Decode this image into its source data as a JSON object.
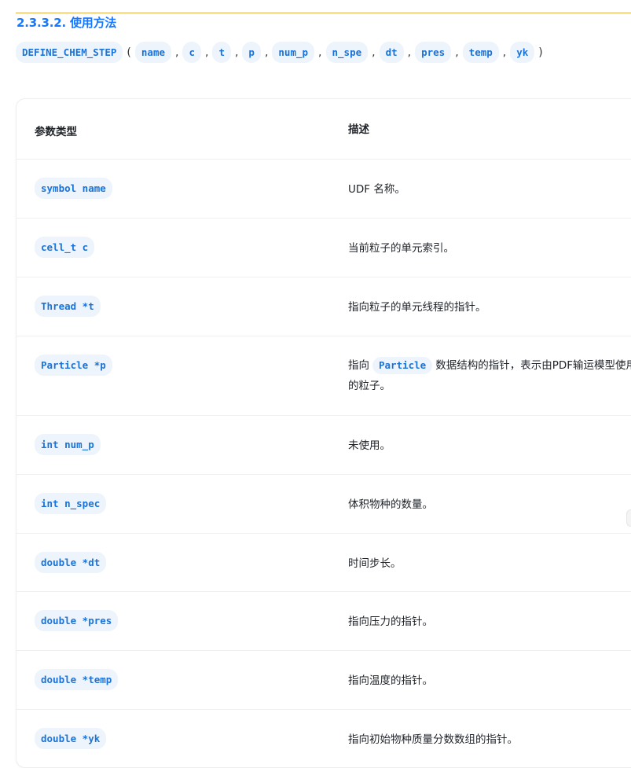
{
  "section": {
    "number_title": "2.3.3.2. 使用方法"
  },
  "signature": {
    "macro": "DEFINE_CHEM_STEP",
    "open_paren": "(",
    "close_paren": ")",
    "separator": ",",
    "args": [
      "name",
      "c",
      "t",
      "p",
      "num_p",
      "n_spe",
      "dt",
      "pres",
      "temp",
      "yk"
    ]
  },
  "table": {
    "headers": {
      "type": "参数类型",
      "desc": "描述"
    },
    "rows": [
      {
        "type": "symbol name",
        "desc": "UDF 名称。"
      },
      {
        "type": "cell_t c",
        "desc": "当前粒子的单元索引。"
      },
      {
        "type": "Thread *t",
        "desc": "指向粒子的单元线程的指针。"
      },
      {
        "type": "Particle *p",
        "desc_before": "指向",
        "desc_code": "Particle",
        "desc_after": "数据结构的指针，表示由PDF输运模型使用的粒子。"
      },
      {
        "type": "int num_p",
        "desc": "未使用。"
      },
      {
        "type": "int n_spec",
        "desc": "体积物种的数量。"
      },
      {
        "type": "double *dt",
        "desc": "时间步长。"
      },
      {
        "type": "double *pres",
        "desc": "指向压力的指针。"
      },
      {
        "type": "double *temp",
        "desc": "指向温度的指针。"
      },
      {
        "type": "double *yk",
        "desc": "指向初始物种质量分数数组的指针。"
      }
    ]
  }
}
